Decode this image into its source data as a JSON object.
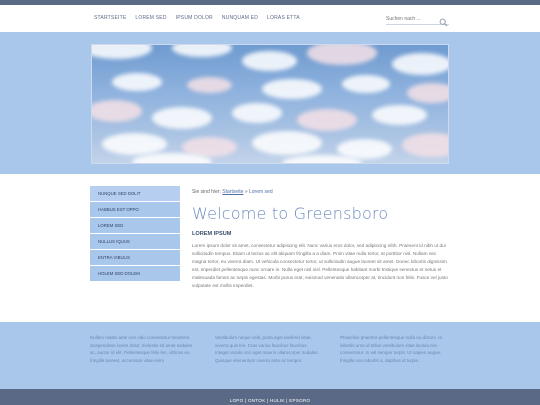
{
  "nav": {
    "items": [
      "STARTSEITE",
      "LOREM SED",
      "IPSUM DOLOR",
      "NUNQUAM ED",
      "LORAS ETTA"
    ]
  },
  "search": {
    "placeholder": "Suchen nach ..."
  },
  "sidebar": {
    "items": [
      "NUNQUE SED DOLIT",
      "HABBUS EST OPPO",
      "LOREM SED",
      "NULLUS IQUUS",
      "ENTRA VIBULIS",
      "HOLEM SED DOLEM"
    ]
  },
  "breadcrumb": {
    "prefix": "Sie sind hier:",
    "home": "Startseite",
    "separator": "»",
    "current": "Lorem sed"
  },
  "main": {
    "title": "Welcome to Greensboro",
    "subtitle": "LOREM IPSUM",
    "paragraph": "Lorem ipsum dolor sit amet, consectetur adipiscing elit. Nunc varius eros dolor, sed adipiscing nibh. Praesent id nibh ut dui sollicitudin tempus. Etiam ut lectus ac elit aliquam fringilla a a diam. Proin vitae nulla tortor, at porttitor nisl. Nullam nec magna tortor, eu viverra diam. Ut vehicula consectetur tortor, ut sollicitudin augue laoreet sit amet. Donec lobortis dignissim est, imperdiet pellentesque nunc ornare in. Nulla eget nisl nisl. Pellentesque habitant morbi tristique senectus et netus et malesuada fames ac turpis egestas. Morbi purus erat, euismod venenatis ullamcorper at, tincidunt non felis. Fusce vel justo vulputate est mollis imperdiet."
  },
  "footer": {
    "col1": "Nullam mattis ante non odio consectetur hendrerit. Suspendisse lorem dolor, molestie sit amet sodales ac, auctor id elit. Pellentesque felis leo, ultrices eu fringilla laoreet, accumsan vitae enim",
    "col2": "Vestibulum neque velit, porta eget eleifend vitae, viverra quis leo. Cras varius faucibus faucibus. Integer iaculis orci eget mauris ullamcorper sodales. Quisque elementum viverra ante ac tempor.",
    "col3": "Phasellus pharetra pellentesque nulla eu dictum. In lobortis urna id tellus vestibulum vitae lacinia nisi consectetur. In vel semper turpis. Ut sapien augue, fringilla non lobortis a, dapibus id turpis.",
    "links": "LOPO | ONTOK | HULIK | EPSORO"
  },
  "colors": {
    "bar": "#5a6a86",
    "band": "#a9c6eb",
    "title": "#6b8ac0"
  }
}
